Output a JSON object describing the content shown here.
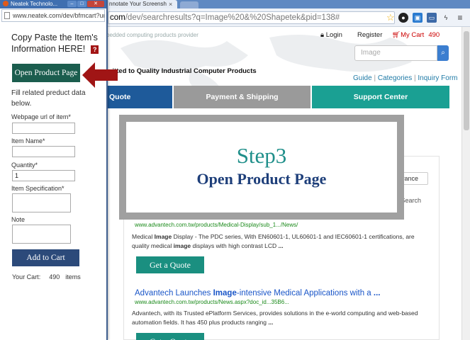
{
  "main_window": {
    "tab_label": "nnotate Your Screensh",
    "tab_close": "×",
    "url_host": "com",
    "url_path": "/dev/searchresults?q=Image%20&%20Shapetek&pid=138#"
  },
  "site": {
    "tagline": "bedded computing products provider",
    "login": "Login",
    "register": "Register",
    "my_cart_label": "My Cart",
    "my_cart_count": "490",
    "search_placeholder": "Image",
    "committed": "mitted to Quality Industrial Computer Products",
    "guide_links": [
      "Guide",
      "Categories",
      "Inquiry Form"
    ],
    "nav": [
      {
        "label": "Quote",
        "color": "#1e5a9a"
      },
      {
        "label": "Payment & Shipping",
        "color": "#9a9a9a"
      },
      {
        "label": "Support Center",
        "color": "#1aa093"
      }
    ],
    "advance_label": "vance",
    "in_search": "n Search",
    "results": [
      {
        "url": "www.advantech.com.tw/products/Medical-Display/sub_1.../News/",
        "desc_parts": [
          "Medical ",
          "Image",
          " Display - The PDC series, With EN60601-1, UL60601-1 and IEC60601-1 certifications, are quality medical ",
          "image",
          " displays with high contrast LCD ",
          "..."
        ],
        "quote_label": "Get a Quote"
      },
      {
        "title_parts": [
          "Advantech Launches ",
          "Image",
          "-intensive Medical Applications with a ",
          "..."
        ],
        "url": "www.advantech.com.tw/products/News.aspx?doc_id...35B6...",
        "desc_parts": [
          "Advantech, with its Trusted ePlatform Services, provides solutions in the e-world computing and web-based automation fields. It has 450 plus products ranging ",
          "..."
        ],
        "quote_label": "Get a Quote"
      }
    ]
  },
  "step": {
    "title": "Step3",
    "subtitle": "Open Product Page"
  },
  "popup": {
    "title": "Neatek Technolo...",
    "url": "www.neatek.com/dev/bfmcart?url=",
    "copy_title": "Copy Paste the Item's Information HERE!",
    "help": "?",
    "open_button": "Open Product Page",
    "fill_text": "Fill related preduct data below.",
    "webpage_label": "Webpage url of item*",
    "webpage_value": "",
    "item_name_label": "Item Name*",
    "item_name_value": "",
    "quantity_label": "Quantity*",
    "quantity_value": "1",
    "spec_label": "Item Specification*",
    "note_label": "Note",
    "add_button": "Add to Cart",
    "your_cart_label": "Your Cart:",
    "your_cart_count": "490",
    "your_cart_unit": "items"
  },
  "colors": {
    "arrow": "#a01515",
    "popup_open_button": "#1b5d4e",
    "popup_add_button": "#2c4a7a",
    "step_title": "#1f8f8a",
    "step_subtitle": "#1e3f7a"
  }
}
